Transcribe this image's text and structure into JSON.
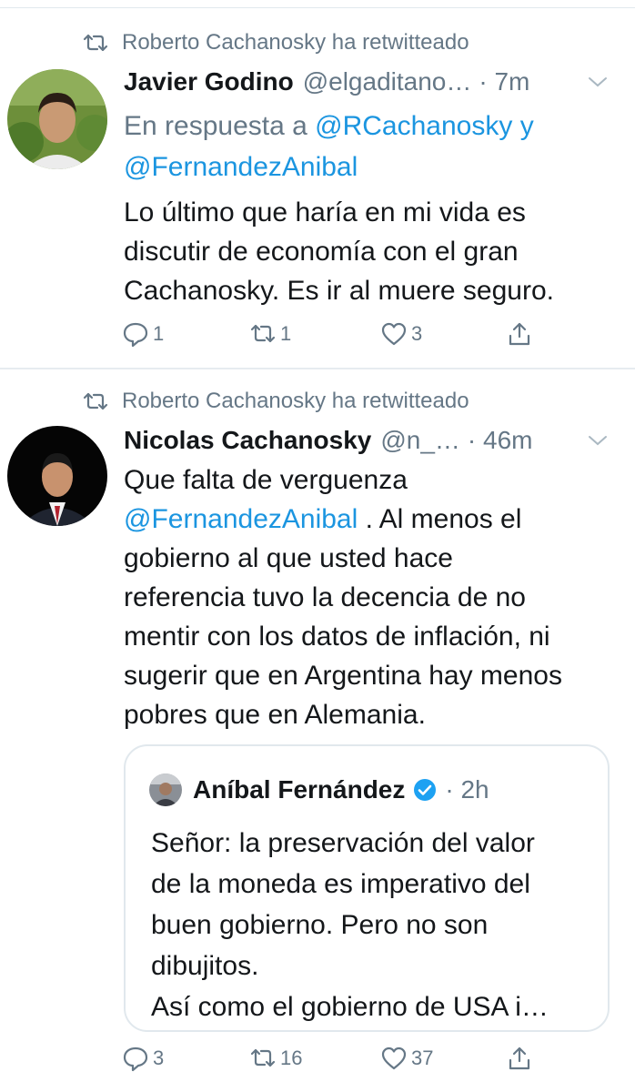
{
  "tweets": [
    {
      "retweeted_by": "Roberto Cachanosky ha retwitteado",
      "name": "Javier Godino",
      "handle": "@elgaditano…",
      "time": "· 7m",
      "reply_prefix": "En respuesta a",
      "reply_to_1": "@RCachanosky",
      "reply_and": "y",
      "reply_to_2": "@FernandezAnibal",
      "lines": [
        "Lo último que haría en mi vida es",
        "discutir de economía con el gran",
        "Cachanosky. Es ir al muere seguro."
      ],
      "replies": "1",
      "retweets": "1",
      "likes": "3"
    },
    {
      "retweeted_by": "Roberto Cachanosky ha retwitteado",
      "name": "Nicolas Cachanosky",
      "handle": "@n_…",
      "time": "· 46m",
      "line1": "Que falta de verguenza",
      "mention": "@FernandezAnibal",
      "line2_rest": ". Al menos el",
      "lines": [
        "gobierno al que usted hace",
        "referencia tuvo la decencia de no",
        "mentir con los datos de inflación, ni",
        "sugerir que en Argentina hay menos",
        "pobres que en Alemania."
      ],
      "replies": "3",
      "retweets": "16",
      "likes": "37",
      "quote": {
        "name": "Aníbal Fernández",
        "time": "· 2h",
        "lines": [
          "Señor: la preservación del valor",
          "de la moneda es imperativo del",
          "buen gobierno. Pero no son",
          "dibujitos.",
          "Así como el gobierno de USA i…"
        ]
      }
    }
  ],
  "colors": {
    "link": "#1b95e0",
    "secondary": "#657786",
    "verified": "#1da1f2"
  },
  "icons": [
    "retweet-icon",
    "chevron-down-icon",
    "reply-icon",
    "like-icon",
    "share-icon",
    "verified-badge-icon"
  ]
}
